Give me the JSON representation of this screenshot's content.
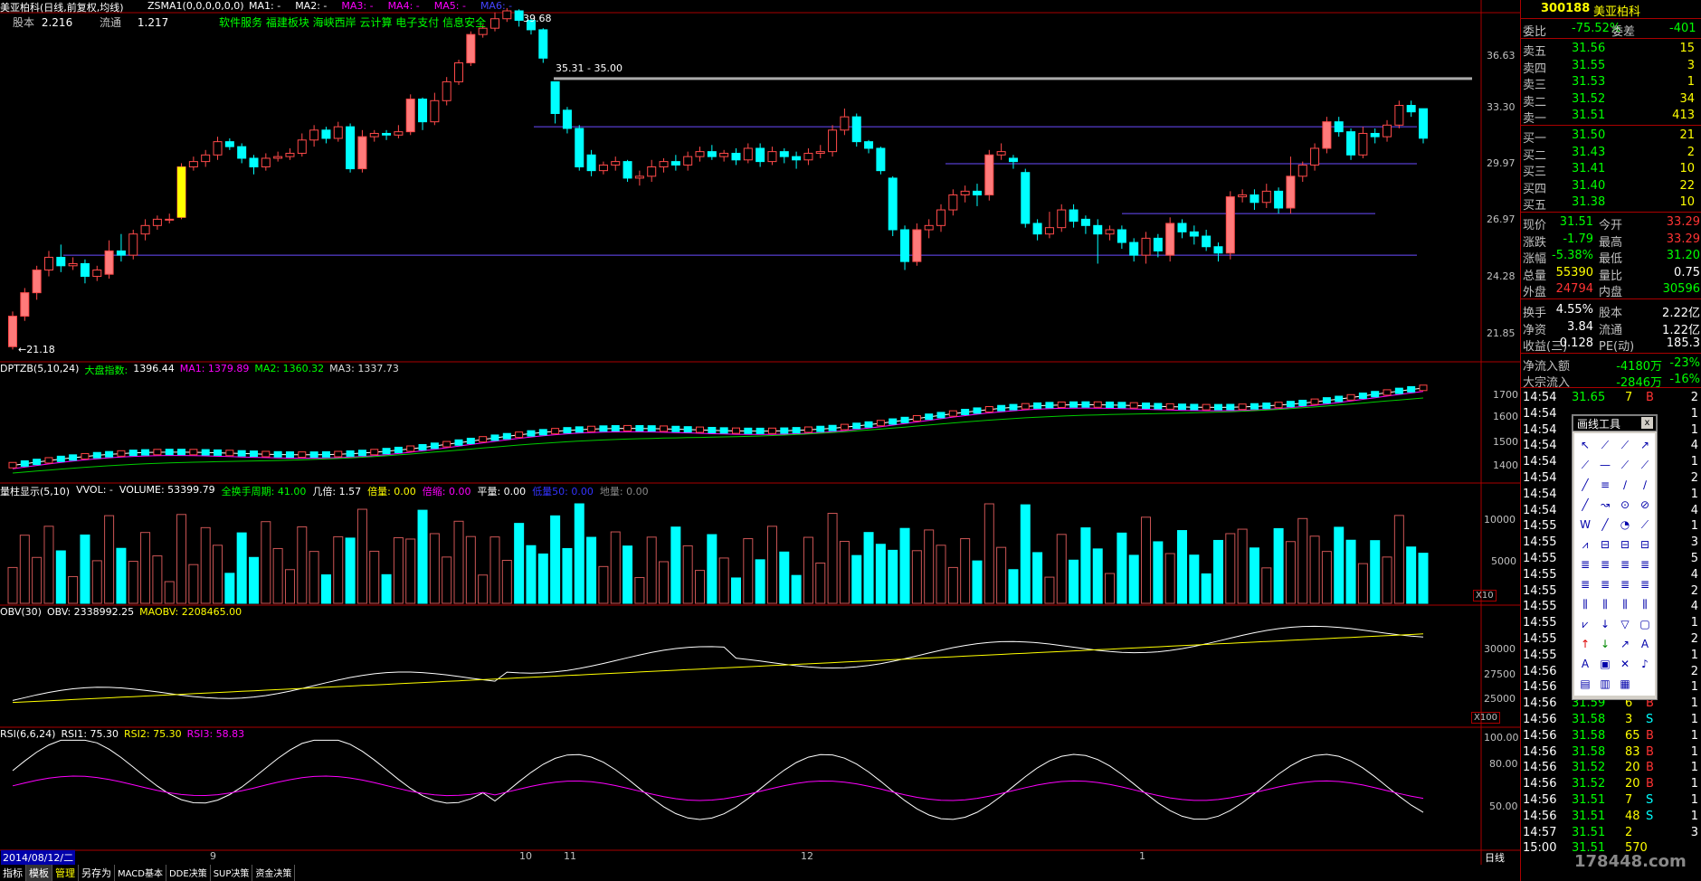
{
  "header": {
    "stock_name_code": "美亚柏科(日线,前复权,均线)",
    "indicator": "ZSMA1(0,0,0,0,0,0)",
    "ma_labels": [
      "MA1: -",
      "MA2: -",
      "MA3: -",
      "MA4: -",
      "MA5: -",
      "MA6: -"
    ],
    "capital_label": "股本",
    "capital_value": "2.216",
    "float_label": "流通",
    "float_value": "1.217",
    "concepts": "软件服务 福建板块 海峡西岸 云计算 电子支付 信息安全"
  },
  "price_axis": [
    "36.63",
    "33.30",
    "29.97",
    "26.97",
    "24.28",
    "21.85"
  ],
  "annotations": {
    "high": "39.68",
    "low": "←21.18",
    "range_line": "35.31 - 35.00"
  },
  "ind1": {
    "title": "DPTZB(5,10,24)",
    "market_label": "大盘指数:",
    "market_value": "1396.44",
    "ma1": "MA1: 1379.89",
    "ma2": "MA2: 1360.32",
    "ma3": "MA3: 1337.73",
    "axis": [
      "1700",
      "1600",
      "1500",
      "1400"
    ]
  },
  "ind2": {
    "title": "量柱显示(5,10)",
    "vvol": "VVOL: -",
    "volume": "VOLUME: 53399.79",
    "full_cycle": "全换手周期: 41.00",
    "ji": "几倍: 1.57",
    "bei": "倍量: 0.00",
    "bs": "倍缩: 0.00",
    "pl": "平量: 0.00",
    "low": "低量50: 0.00",
    "dl": "地量: 0.00",
    "axis": [
      "10000",
      "5000"
    ],
    "unit": "X10"
  },
  "ind3": {
    "title": "OBV(30)",
    "obv": "OBV: 2338992.25",
    "maobv": "MAOBV: 2208465.00",
    "axis": [
      "30000",
      "27500",
      "25000"
    ],
    "unit": "X100"
  },
  "ind4": {
    "title": "RSI(6,6,24)",
    "rsi1": "RSI1: 75.30",
    "rsi2": "RSI2: 75.30",
    "rsi3": "RSI3: 58.83",
    "axis": [
      "100.00",
      "80.00",
      "50.00"
    ]
  },
  "date_axis": {
    "start": "2014/08/12/二",
    "months": [
      "9",
      "10",
      "11",
      "12",
      "1"
    ],
    "period": "日线"
  },
  "bottom_tabs": [
    "指标",
    "模板",
    "管理",
    "另存为",
    "MACD基本",
    "DDE决策",
    "SUP决策",
    "资金决策"
  ],
  "side": {
    "code": "300188",
    "name": "美亚柏科",
    "ratio": {
      "label": "委比",
      "value": "-75.52%",
      "diff_label": "委差",
      "diff": "-401"
    },
    "sells": [
      {
        "label": "卖五",
        "price": "31.56",
        "vol": "15"
      },
      {
        "label": "卖四",
        "price": "31.55",
        "vol": "3"
      },
      {
        "label": "卖三",
        "price": "31.53",
        "vol": "1"
      },
      {
        "label": "卖二",
        "price": "31.52",
        "vol": "34"
      },
      {
        "label": "卖一",
        "price": "31.51",
        "vol": "413"
      }
    ],
    "buys": [
      {
        "label": "买一",
        "price": "31.50",
        "vol": "21"
      },
      {
        "label": "买二",
        "price": "31.43",
        "vol": "2"
      },
      {
        "label": "买三",
        "price": "31.41",
        "vol": "10"
      },
      {
        "label": "买四",
        "price": "31.40",
        "vol": "22"
      },
      {
        "label": "买五",
        "price": "31.38",
        "vol": "10"
      }
    ],
    "quote": [
      {
        "l1": "现价",
        "v1": "31.51",
        "l2": "今开",
        "v2": "33.29"
      },
      {
        "l1": "涨跌",
        "v1": "-1.79",
        "l2": "最高",
        "v2": "33.29"
      },
      {
        "l1": "涨幅",
        "v1": "-5.38%",
        "l2": "最低",
        "v2": "31.20"
      },
      {
        "l1": "总量",
        "v1": "55390",
        "l2": "量比",
        "v2": "0.75"
      },
      {
        "l1": "外盘",
        "v1": "24794",
        "l2": "内盘",
        "v2": "30596"
      }
    ],
    "fund": [
      {
        "l1": "换手",
        "v1": "4.55%",
        "l2": "股本",
        "v2": "2.22亿"
      },
      {
        "l1": "净资",
        "v1": "3.84",
        "l2": "流通",
        "v2": "1.22亿"
      },
      {
        "l1": "收益(三)",
        "v1": "0.128",
        "l2": "PE(动)",
        "v2": "185.3"
      }
    ],
    "flow": [
      {
        "label": "净流入额",
        "value": "-4180万",
        "pct": "-23%"
      },
      {
        "label": "大宗流入",
        "value": "-2846万",
        "pct": "-16%"
      }
    ],
    "ticks": [
      {
        "t": "14:54",
        "p": "31.65",
        "v": "7",
        "d": "B"
      },
      {
        "t": "14:54",
        "p": "",
        "v": "",
        "d": ""
      },
      {
        "t": "14:54",
        "p": "",
        "v": "",
        "d": ""
      },
      {
        "t": "14:54",
        "p": "",
        "v": "",
        "d": ""
      },
      {
        "t": "14:54",
        "p": "",
        "v": "",
        "d": ""
      },
      {
        "t": "14:54",
        "p": "",
        "v": "",
        "d": ""
      },
      {
        "t": "14:54",
        "p": "",
        "v": "",
        "d": ""
      },
      {
        "t": "14:54",
        "p": "",
        "v": "",
        "d": ""
      },
      {
        "t": "14:55",
        "p": "",
        "v": "",
        "d": ""
      },
      {
        "t": "14:55",
        "p": "",
        "v": "",
        "d": ""
      },
      {
        "t": "14:55",
        "p": "",
        "v": "",
        "d": ""
      },
      {
        "t": "14:55",
        "p": "",
        "v": "",
        "d": ""
      },
      {
        "t": "14:55",
        "p": "",
        "v": "",
        "d": ""
      },
      {
        "t": "14:55",
        "p": "",
        "v": "",
        "d": ""
      },
      {
        "t": "14:55",
        "p": "",
        "v": "",
        "d": ""
      },
      {
        "t": "14:55",
        "p": "",
        "v": "",
        "d": ""
      },
      {
        "t": "14:55",
        "p": "",
        "v": "",
        "d": ""
      },
      {
        "t": "14:56",
        "p": "",
        "v": "",
        "d": ""
      },
      {
        "t": "14:56",
        "p": "",
        "v": "",
        "d": ""
      },
      {
        "t": "14:56",
        "p": "31.59",
        "v": "6",
        "d": "B"
      },
      {
        "t": "14:56",
        "p": "31.58",
        "v": "3",
        "d": "S"
      },
      {
        "t": "14:56",
        "p": "31.58",
        "v": "65",
        "d": "B"
      },
      {
        "t": "14:56",
        "p": "31.58",
        "v": "83",
        "d": "B"
      },
      {
        "t": "14:56",
        "p": "31.52",
        "v": "20",
        "d": "B"
      },
      {
        "t": "14:56",
        "p": "31.52",
        "v": "20",
        "d": "B"
      },
      {
        "t": "14:56",
        "p": "31.51",
        "v": "7",
        "d": "S"
      },
      {
        "t": "14:56",
        "p": "31.51",
        "v": "48",
        "d": "S"
      },
      {
        "t": "14:57",
        "p": "31.51",
        "v": "2",
        "d": ""
      },
      {
        "t": "15:00",
        "p": "31.51",
        "v": "570",
        "d": ""
      }
    ],
    "right_col": [
      "2",
      "1",
      "1",
      "4",
      "1",
      "2",
      "1",
      "4",
      "1",
      "3",
      "5",
      "4",
      "2",
      "4",
      "1",
      "2",
      "1",
      "2",
      "1",
      "1",
      "1",
      "1",
      "1",
      "1",
      "1",
      "1",
      "1",
      "3"
    ],
    "drawtool_title": "画线工具",
    "close_x": "x"
  },
  "watermark": "178448.com",
  "colors": {
    "up": "#ff3a3a",
    "down": "#00ffff",
    "bg": "#000000",
    "axis": "#a00000"
  },
  "chart_data": {
    "type": "candlestick",
    "price_axis": {
      "labels": [
        36.63,
        33.3,
        29.97,
        26.97,
        24.28,
        21.85
      ]
    },
    "candles": [
      [
        21.3,
        22.6,
        21.18,
        22.8
      ],
      [
        22.6,
        23.6,
        22.4,
        23.8
      ],
      [
        23.6,
        24.6,
        23.3,
        24.8
      ],
      [
        24.6,
        25.2,
        24.3,
        25.5
      ],
      [
        25.2,
        24.8,
        24.5,
        25.8
      ],
      [
        24.8,
        24.9,
        24.6,
        25.2
      ],
      [
        24.9,
        24.3,
        24.0,
        25.1
      ],
      [
        24.3,
        24.6,
        24.1,
        24.8
      ],
      [
        24.4,
        25.5,
        24.2,
        26.0
      ],
      [
        25.5,
        25.3,
        25.0,
        26.3
      ],
      [
        25.3,
        26.3,
        25.1,
        26.5
      ],
      [
        26.3,
        26.7,
        26.0,
        27.0
      ],
      [
        26.7,
        27.0,
        26.5,
        27.2
      ],
      [
        27.0,
        27.0,
        26.8,
        27.3
      ],
      [
        27.1,
        29.8,
        27.0,
        30.0
      ],
      [
        29.8,
        30.1,
        29.6,
        30.4
      ],
      [
        30.1,
        30.5,
        29.8,
        30.8
      ],
      [
        30.5,
        31.3,
        30.2,
        31.6
      ],
      [
        31.3,
        31.0,
        30.8,
        31.5
      ],
      [
        31.0,
        30.3,
        30.0,
        31.2
      ],
      [
        30.3,
        29.8,
        29.4,
        30.5
      ],
      [
        29.8,
        30.3,
        29.6,
        30.6
      ],
      [
        30.3,
        30.4,
        30.1,
        30.7
      ],
      [
        30.4,
        30.6,
        30.2,
        30.9
      ],
      [
        30.6,
        31.4,
        30.4,
        31.8
      ],
      [
        31.4,
        32.0,
        31.0,
        32.3
      ],
      [
        32.0,
        31.5,
        31.2,
        32.2
      ],
      [
        31.5,
        32.2,
        31.3,
        32.5
      ],
      [
        32.2,
        29.7,
        29.5,
        32.4
      ],
      [
        29.7,
        31.6,
        29.5,
        32.0
      ],
      [
        31.6,
        31.8,
        31.3,
        32.0
      ],
      [
        31.8,
        31.7,
        31.4,
        32.0
      ],
      [
        31.7,
        31.9,
        31.5,
        32.3
      ],
      [
        31.9,
        33.9,
        31.7,
        34.2
      ],
      [
        33.9,
        32.5,
        32.0,
        34.0
      ],
      [
        32.5,
        33.8,
        32.3,
        34.3
      ],
      [
        33.8,
        35.0,
        33.5,
        35.3
      ],
      [
        35.0,
        36.2,
        34.8,
        36.4
      ],
      [
        36.2,
        38.0,
        36.0,
        38.2
      ],
      [
        38.0,
        38.4,
        37.8,
        38.6
      ],
      [
        38.4,
        39.0,
        38.2,
        39.4
      ],
      [
        39.0,
        39.5,
        38.8,
        39.68
      ],
      [
        39.5,
        38.9,
        38.5,
        39.6
      ],
      [
        38.9,
        38.3,
        38.0,
        39.0
      ],
      [
        38.3,
        36.5,
        36.2,
        38.4
      ],
      [
        35.0,
        33.0,
        32.4,
        35.0
      ],
      [
        33.2,
        32.1,
        31.8,
        33.4
      ],
      [
        32.1,
        29.8,
        29.6,
        32.3
      ],
      [
        30.5,
        29.6,
        29.3,
        30.8
      ],
      [
        29.6,
        29.9,
        29.4,
        30.1
      ],
      [
        29.9,
        30.1,
        29.6,
        30.4
      ],
      [
        30.1,
        29.2,
        29.0,
        30.2
      ],
      [
        29.2,
        29.3,
        28.8,
        29.6
      ],
      [
        29.3,
        29.8,
        29.0,
        30.2
      ],
      [
        29.8,
        30.1,
        29.5,
        30.3
      ],
      [
        30.1,
        29.9,
        29.6,
        30.5
      ],
      [
        29.9,
        30.4,
        29.6,
        30.7
      ],
      [
        30.4,
        30.7,
        30.1,
        31.0
      ],
      [
        30.7,
        30.4,
        30.2,
        31.1
      ],
      [
        30.4,
        30.6,
        30.1,
        30.8
      ],
      [
        30.6,
        30.2,
        29.9,
        30.9
      ],
      [
        30.2,
        30.9,
        30.0,
        31.2
      ],
      [
        30.9,
        30.1,
        29.8,
        31.2
      ],
      [
        30.1,
        30.7,
        29.9,
        31.0
      ],
      [
        30.7,
        30.4,
        30.0,
        30.9
      ],
      [
        30.4,
        30.2,
        29.7,
        30.7
      ],
      [
        30.2,
        30.6,
        29.9,
        30.9
      ],
      [
        30.6,
        30.7,
        30.3,
        31.1
      ],
      [
        30.7,
        32.0,
        30.4,
        32.3
      ],
      [
        32.0,
        32.8,
        31.7,
        33.3
      ],
      [
        32.8,
        31.3,
        31.0,
        33.0
      ],
      [
        31.3,
        30.9,
        30.6,
        31.4
      ],
      [
        30.9,
        29.6,
        29.4,
        31.0
      ],
      [
        29.2,
        26.5,
        26.2,
        29.3
      ],
      [
        26.5,
        25.0,
        24.6,
        26.7
      ],
      [
        25.0,
        26.5,
        24.8,
        26.8
      ],
      [
        26.5,
        26.7,
        26.1,
        27.0
      ],
      [
        26.7,
        27.5,
        26.4,
        27.8
      ],
      [
        27.5,
        28.3,
        27.2,
        28.6
      ],
      [
        28.3,
        28.5,
        27.9,
        28.8
      ],
      [
        28.5,
        28.3,
        27.7,
        28.9
      ],
      [
        28.3,
        30.5,
        28.0,
        30.8
      ],
      [
        30.5,
        30.7,
        30.2,
        31.2
      ],
      [
        30.3,
        30.1,
        29.7,
        30.5
      ],
      [
        29.5,
        26.8,
        26.6,
        29.7
      ],
      [
        26.8,
        26.3,
        26.0,
        27.0
      ],
      [
        26.3,
        26.6,
        26.1,
        27.4
      ],
      [
        26.6,
        27.5,
        26.4,
        27.8
      ],
      [
        27.5,
        26.9,
        26.6,
        27.8
      ],
      [
        27.0,
        26.7,
        26.3,
        27.2
      ],
      [
        26.7,
        26.3,
        24.9,
        27.0
      ],
      [
        26.3,
        26.5,
        26.0,
        26.7
      ],
      [
        26.5,
        25.9,
        25.6,
        26.7
      ],
      [
        25.9,
        25.3,
        25.0,
        26.1
      ],
      [
        25.3,
        26.1,
        24.9,
        26.4
      ],
      [
        26.1,
        25.5,
        25.2,
        26.3
      ],
      [
        25.3,
        26.8,
        25.0,
        27.1
      ],
      [
        26.8,
        26.4,
        26.1,
        27.0
      ],
      [
        26.4,
        26.2,
        25.8,
        26.7
      ],
      [
        26.2,
        25.7,
        25.5,
        26.5
      ],
      [
        25.7,
        25.4,
        25.0,
        25.9
      ],
      [
        25.4,
        28.2,
        25.1,
        28.5
      ],
      [
        28.2,
        28.3,
        27.9,
        28.6
      ],
      [
        28.3,
        27.9,
        27.5,
        28.6
      ],
      [
        27.9,
        28.5,
        27.6,
        28.9
      ],
      [
        28.5,
        27.6,
        27.3,
        28.7
      ],
      [
        27.6,
        29.3,
        27.3,
        30.4
      ],
      [
        29.3,
        29.9,
        29.0,
        30.1
      ],
      [
        29.9,
        30.9,
        29.6,
        31.2
      ],
      [
        30.9,
        32.5,
        30.6,
        32.8
      ],
      [
        32.5,
        31.9,
        31.6,
        32.8
      ],
      [
        31.9,
        30.5,
        30.2,
        32.1
      ],
      [
        30.5,
        31.8,
        30.3,
        32.2
      ],
      [
        31.8,
        31.6,
        31.2,
        32.1
      ],
      [
        31.6,
        32.3,
        31.3,
        32.6
      ],
      [
        32.3,
        33.5,
        32.1,
        33.8
      ],
      [
        33.5,
        33.1,
        32.8,
        33.8
      ],
      [
        33.29,
        31.51,
        31.2,
        33.29
      ]
    ]
  }
}
